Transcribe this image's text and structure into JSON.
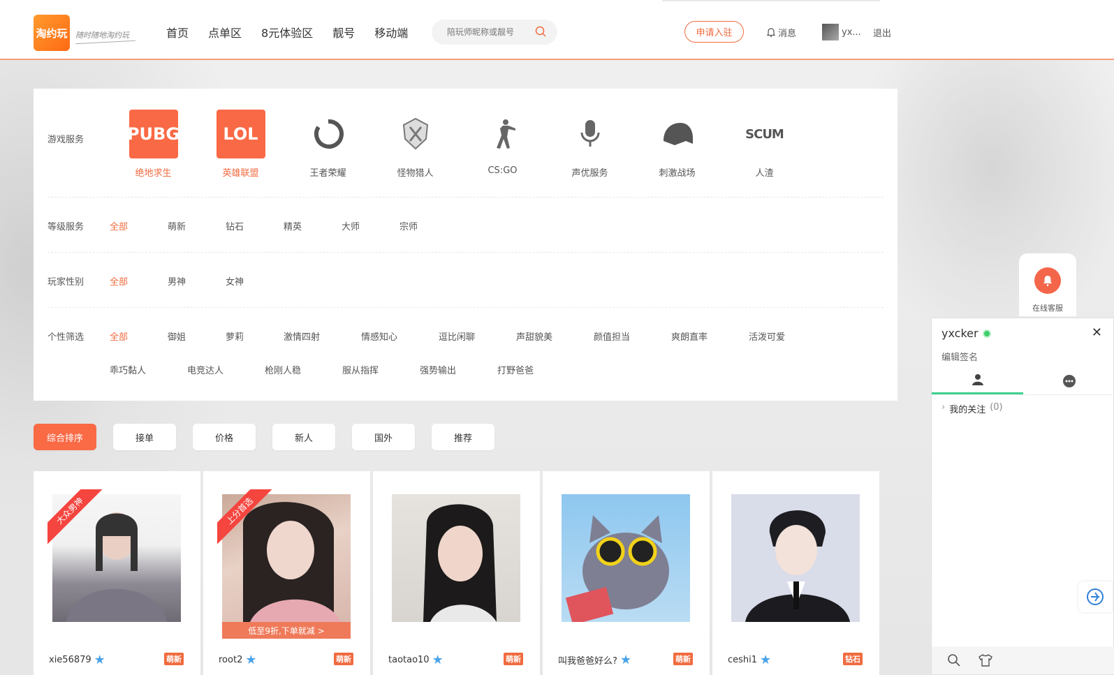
{
  "header": {
    "logo_text": "淘约玩",
    "slogan": "随时随地淘约玩",
    "nav": [
      "首页",
      "点单区",
      "8元体验区",
      "靓号",
      "移动端"
    ],
    "search_placeholder": "陪玩师昵称或靓号",
    "apply_label": "申请入驻",
    "messages_label": "消息",
    "user_short": "yx...",
    "logout_label": "退出"
  },
  "filters": {
    "game_label": "游戏服务",
    "games": [
      {
        "name": "绝地求生",
        "icon": "PUBG",
        "active": true
      },
      {
        "name": "英雄联盟",
        "icon": "LOL",
        "active": true
      },
      {
        "name": "王者荣耀",
        "icon": "ring-icon",
        "active": false
      },
      {
        "name": "怪物猎人",
        "icon": "crest-icon",
        "active": false
      },
      {
        "name": "CS:GO",
        "icon": "soldier-icon",
        "active": false
      },
      {
        "name": "声优服务",
        "icon": "microphone-icon",
        "active": false
      },
      {
        "name": "刺激战场",
        "icon": "helmet-icon",
        "active": false
      },
      {
        "name": "人渣",
        "icon": "SCUM",
        "active": false
      }
    ],
    "level_label": "等级服务",
    "levels": [
      "全部",
      "萌新",
      "钻石",
      "精英",
      "大师",
      "宗师"
    ],
    "gender_label": "玩家性别",
    "genders": [
      "全部",
      "男神",
      "女神"
    ],
    "personality_label": "个性筛选",
    "personality_row1": [
      "全部",
      "御姐",
      "萝莉",
      "激情四射",
      "情感知心",
      "逗比闲聊",
      "声甜貌美",
      "颜值担当",
      "爽朗直率",
      "活泼可爱"
    ],
    "personality_row2": [
      "乖巧黏人",
      "电竞达人",
      "枪刚人稳",
      "服从指挥",
      "强势输出",
      "打野爸爸"
    ]
  },
  "sort_tabs": [
    "综合排序",
    "接单",
    "价格",
    "新人",
    "国外",
    "推荐"
  ],
  "cards": [
    {
      "name": "xie56879",
      "level": "萌新",
      "ribbon": "大众男神",
      "promo": ""
    },
    {
      "name": "root2",
      "level": "萌新",
      "ribbon": "上分首选",
      "promo": "低至9折,下单就减 >"
    },
    {
      "name": "taotao10",
      "level": "萌新",
      "ribbon": "",
      "promo": ""
    },
    {
      "name": "叫我爸爸好么?",
      "level": "萌新",
      "ribbon": "",
      "promo": ""
    },
    {
      "name": "ceshi1",
      "level": "钻石",
      "ribbon": "",
      "promo": ""
    }
  ],
  "customer_service": {
    "label": "在线客服"
  },
  "chat_panel": {
    "username": "yxcker",
    "signature": "编辑签名",
    "follow_label": "我的关注",
    "follow_count": "(0)"
  },
  "colors": {
    "accent": "#f06b3f",
    "online": "#3ecf6b"
  }
}
